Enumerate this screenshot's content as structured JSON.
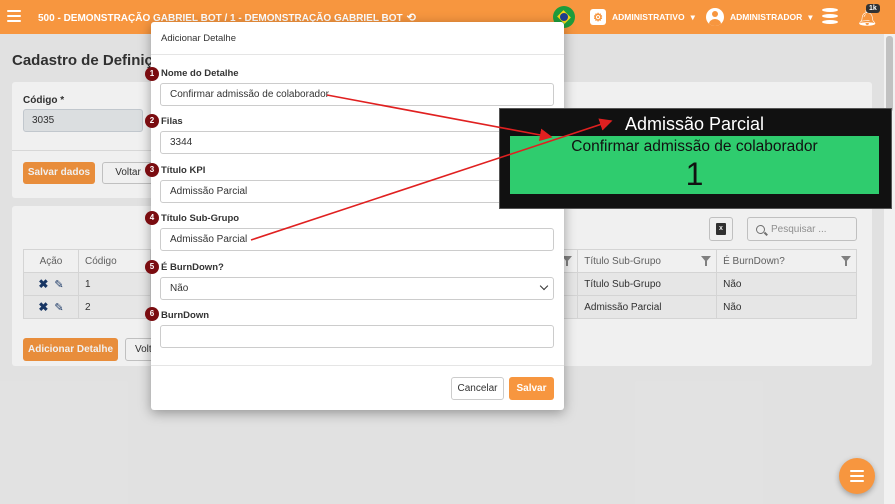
{
  "header": {
    "title": "500 - DEMONSTRAÇÃO GABRIEL BOT / 1 - DEMONSTRAÇÃO GABRIEL BOT",
    "admin_menu": "ADMINISTRATIVO",
    "user_menu": "ADMINISTRADOR",
    "notif_badge": "1k",
    "accent": "#f7963f"
  },
  "page": {
    "title": "Cadastro de Definiçõ",
    "codigo_label": "Código *",
    "codigo_value": "3035",
    "save_button": "Salvar dados",
    "back_button": "Voltar",
    "search_placeholder": "Pesquisar ...",
    "excel_icon": "excel-export-icon"
  },
  "table": {
    "columns": [
      "Ação",
      "Código",
      "Título Sub-Grupo",
      "É BurnDown?"
    ],
    "rows": [
      {
        "codigo": "1",
        "subgrupo": "Título Sub-Grupo",
        "burndown": "Não"
      },
      {
        "codigo": "2",
        "subgrupo": "Admissão Parcial",
        "burndown": "Não"
      }
    ],
    "add_detail_button": "Adicionar Detalhe",
    "back_button": "Volt"
  },
  "modal": {
    "title": "Adicionar Detalhe",
    "fields": [
      {
        "num": "1",
        "label": "Nome do Detalhe",
        "value": "Confirmar admissão de colaborador"
      },
      {
        "num": "2",
        "label": "Filas",
        "value": "3344"
      },
      {
        "num": "3",
        "label": "Título KPI",
        "value": "Admissão Parcial"
      },
      {
        "num": "4",
        "label": "Título Sub-Grupo",
        "value": "Admissão Parcial"
      },
      {
        "num": "5",
        "label": "É BurnDown?",
        "value": "Não"
      },
      {
        "num": "6",
        "label": "BurnDown",
        "value": ""
      }
    ],
    "cancel_button": "Cancelar",
    "save_button": "Salvar"
  },
  "kpi": {
    "title": "Admissão Parcial",
    "subtitle": "Confirmar admissão de colaborador",
    "value": "1",
    "box_color": "#2fcc6e"
  },
  "annotation_color": "#e02020"
}
